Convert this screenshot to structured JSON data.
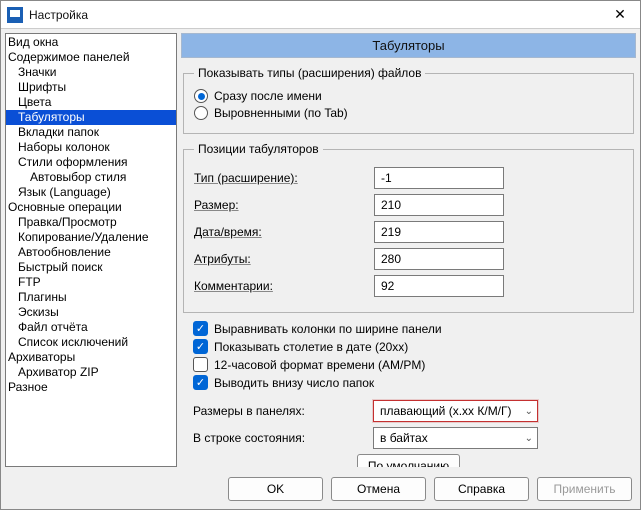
{
  "window": {
    "title": "Настройка"
  },
  "page_title": "Табуляторы",
  "tree": {
    "items": [
      {
        "label": "Вид окна",
        "indent": 0
      },
      {
        "label": "Содержимое панелей",
        "indent": 0
      },
      {
        "label": "Значки",
        "indent": 1
      },
      {
        "label": "Шрифты",
        "indent": 1
      },
      {
        "label": "Цвета",
        "indent": 1
      },
      {
        "label": "Табуляторы",
        "indent": 1,
        "selected": true
      },
      {
        "label": "Вкладки папок",
        "indent": 1
      },
      {
        "label": "Наборы колонок",
        "indent": 1
      },
      {
        "label": "Стили оформления",
        "indent": 1
      },
      {
        "label": "Автовыбор стиля",
        "indent": 2
      },
      {
        "label": "Язык (Language)",
        "indent": 1
      },
      {
        "label": "Основные операции",
        "indent": 0
      },
      {
        "label": "Правка/Просмотр",
        "indent": 1
      },
      {
        "label": "Копирование/Удаление",
        "indent": 1
      },
      {
        "label": "Автообновление",
        "indent": 1
      },
      {
        "label": "Быстрый поиск",
        "indent": 1
      },
      {
        "label": "FTP",
        "indent": 1
      },
      {
        "label": "Плагины",
        "indent": 1
      },
      {
        "label": "Эскизы",
        "indent": 1
      },
      {
        "label": "Файл отчёта",
        "indent": 1
      },
      {
        "label": "Список исключений",
        "indent": 1
      },
      {
        "label": "Архиваторы",
        "indent": 0
      },
      {
        "label": "Архиватор ZIP",
        "indent": 1
      },
      {
        "label": "Разное",
        "indent": 0
      }
    ]
  },
  "group_types": {
    "legend": "Показывать типы (расширения) файлов",
    "opt1": "Сразу после имени",
    "opt2": "Выровненными (по Tab)",
    "selected": 0
  },
  "group_positions": {
    "legend": "Позиции табуляторов",
    "rows": [
      {
        "label": "Тип (расширение):",
        "value": "-1"
      },
      {
        "label": "Размер:",
        "value": "210"
      },
      {
        "label": "Дата/время:",
        "value": "219"
      },
      {
        "label": "Атрибуты:",
        "value": "280"
      },
      {
        "label": "Комментарии:",
        "value": "92"
      }
    ]
  },
  "checks": [
    {
      "label": "Выравнивать колонки по ширине панели",
      "checked": true
    },
    {
      "label": "Показывать столетие в дате (20xx)",
      "checked": true
    },
    {
      "label": "12-часовой формат времени (AM/PM)",
      "checked": false
    },
    {
      "label": "Выводить внизу число папок",
      "checked": true
    }
  ],
  "combos": {
    "sizes_label": "Размеры в панелях:",
    "sizes_value": "плавающий (x.xx К/М/Г)",
    "status_label": "В строке состояния:",
    "status_value": "в байтах"
  },
  "buttons": {
    "default": "По умолчанию",
    "ok": "OK",
    "cancel": "Отмена",
    "help": "Справка",
    "apply": "Применить"
  }
}
